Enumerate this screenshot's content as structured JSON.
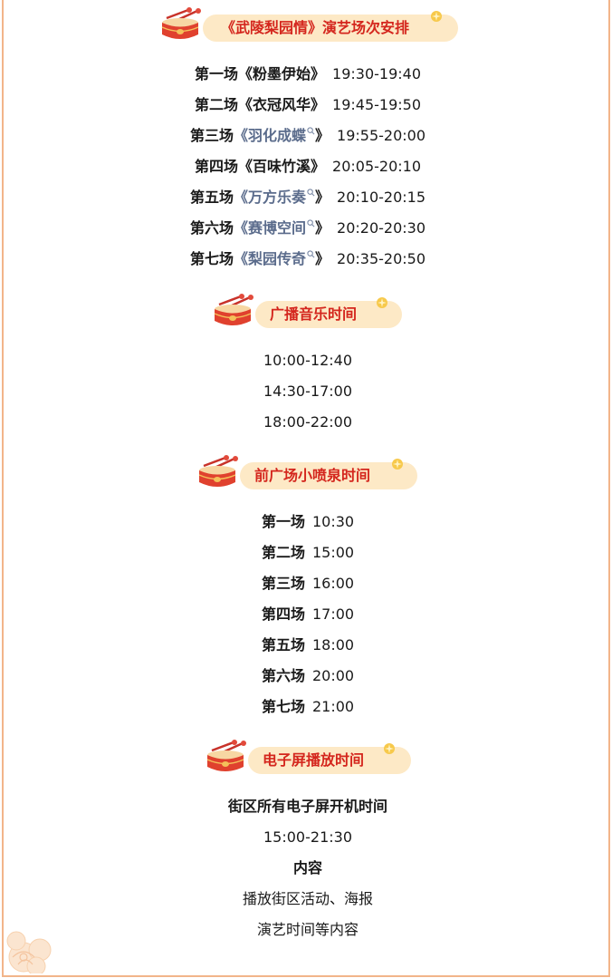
{
  "sections": {
    "schedule": {
      "title": "《武陵梨园情》演艺场次安排",
      "shows": [
        {
          "label": "第一场",
          "open": "《",
          "name": "粉墨伊始",
          "close": "》",
          "link": false,
          "time": "19:30-19:40"
        },
        {
          "label": "第二场",
          "open": "《",
          "name": "衣冠风华",
          "close": "》",
          "link": false,
          "time": "19:45-19:50"
        },
        {
          "label": "第三场",
          "open": "《",
          "name": "羽化成蝶",
          "close": "》",
          "link": true,
          "time": "19:55-20:00"
        },
        {
          "label": "第四场",
          "open": "《",
          "name": "百味竹溪",
          "close": "》",
          "link": false,
          "time": "20:05-20:10"
        },
        {
          "label": "第五场",
          "open": "《",
          "name": "万方乐奏",
          "close": "》",
          "link": true,
          "time": "20:10-20:15"
        },
        {
          "label": "第六场",
          "open": "《",
          "name": "赛博空间",
          "close": "》",
          "link": true,
          "time": "20:20-20:30"
        },
        {
          "label": "第七场",
          "open": "《",
          "name": "梨园传奇",
          "close": "》",
          "link": true,
          "time": "20:35-20:50"
        }
      ]
    },
    "broadcast": {
      "title": "广播音乐时间",
      "times": [
        "10:00-12:40",
        "14:30-17:00",
        "18:00-22:00"
      ]
    },
    "fountain": {
      "title": "前广场小喷泉时间",
      "shows": [
        {
          "label": "第一场",
          "time": "10:30"
        },
        {
          "label": "第二场",
          "time": "15:00"
        },
        {
          "label": "第三场",
          "time": "16:00"
        },
        {
          "label": "第四场",
          "time": "17:00"
        },
        {
          "label": "第五场",
          "time": "18:00"
        },
        {
          "label": "第六场",
          "time": "20:00"
        },
        {
          "label": "第七场",
          "time": "21:00"
        }
      ]
    },
    "screens": {
      "title": "电子屏播放时间",
      "power_label": "街区所有电子屏开机时间",
      "power_time": "15:00-21:30",
      "content_label": "内容",
      "content_line1": "播放街区活动、海报",
      "content_line2": "演艺时间等内容"
    }
  },
  "colors": {
    "accent_red": "#d4261d",
    "pill_bg": "#fde9c6",
    "link_gray_blue": "#5b6c8c",
    "frame_orange": "#f2b58a"
  },
  "icons": {
    "drum": "drum-icon",
    "sparkle": "sparkle-icon",
    "search": "search-icon",
    "flower": "flower-icon"
  }
}
